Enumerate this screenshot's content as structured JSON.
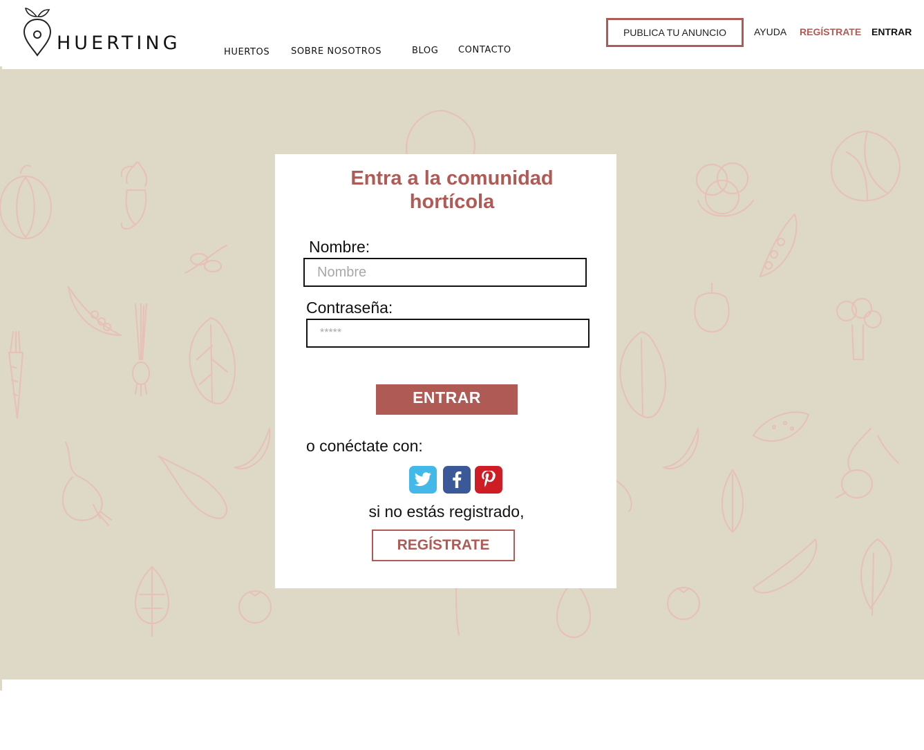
{
  "brand": {
    "name": "HUERTING"
  },
  "nav": {
    "items": [
      "HUERTOS",
      "SOBRE NOSOTROS",
      "BLOG",
      "CONTACTO"
    ]
  },
  "topbar": {
    "publish_label": "PUBLICA TU ANUNCIO",
    "help_label": "AYUDA",
    "register_label": "REGÍSTRATE",
    "login_label": "ENTRAR"
  },
  "login": {
    "title_line1": "Entra a la comunidad",
    "title_line2": "hortícola",
    "name_label": "Nombre:",
    "name_placeholder": "Nombre",
    "password_label": "Contraseña:",
    "password_placeholder": "*****",
    "submit_label": "ENTRAR",
    "social_label": "o conéctate con:",
    "social_networks": [
      "twitter",
      "facebook",
      "pinterest"
    ],
    "not_registered": "si no estás registrado,",
    "register_label": "REGÍSTRATE"
  },
  "colors": {
    "accent": "#b05a56",
    "background": "#ded9c7",
    "twitter": "#43b9ea",
    "facebook": "#3b5898",
    "pinterest": "#cf1d26"
  },
  "icons": [
    "pin-leaf-logo-icon",
    "twitter-icon",
    "facebook-icon",
    "pinterest-icon",
    "vegetable-pattern"
  ]
}
